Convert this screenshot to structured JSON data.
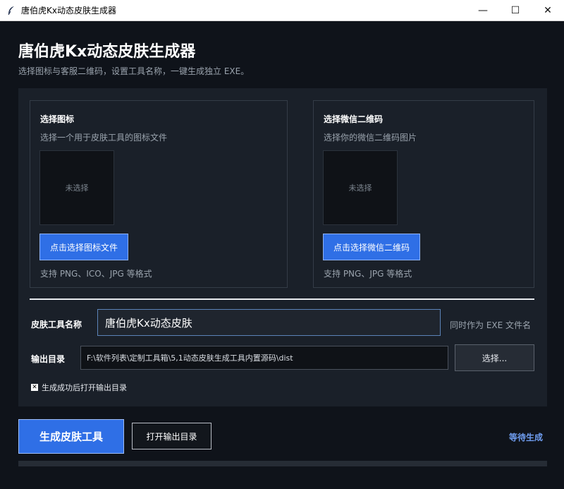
{
  "window": {
    "title": "唐伯虎Kx动态皮肤生成器",
    "controls": {
      "minimize": "—",
      "maximize": "☐",
      "close": "✕"
    }
  },
  "header": {
    "title": "唐伯虎Kx动态皮肤生成器",
    "subtitle": "选择图标与客服二维码，设置工具名称，一键生成独立 EXE。"
  },
  "icon_card": {
    "title": "选择图标",
    "description": "选择一个用于皮肤工具的图标文件",
    "preview_placeholder": "未选择",
    "button_label": "点击选择图标文件",
    "hint": "支持 PNG、ICO、JPG 等格式"
  },
  "qr_card": {
    "title": "选择微信二维码",
    "description": "选择你的微信二维码图片",
    "preview_placeholder": "未选择",
    "button_label": "点击选择微信二维码",
    "hint": "支持 PNG、JPG 等格式"
  },
  "form": {
    "name_label": "皮肤工具名称",
    "name_value": "唐伯虎Kx动态皮肤",
    "name_hint": "同时作为 EXE 文件名",
    "dir_label": "输出目录",
    "dir_value": "F:\\软件列表\\定制工具箱\\5,1动态皮肤生成工具内置源码\\dist",
    "browse_label": "选择...",
    "open_after_label": "生成成功后打开输出目录",
    "open_after_checked": true
  },
  "actions": {
    "generate_label": "生成皮肤工具",
    "open_dir_label": "打开输出目录",
    "status": "等待生成",
    "progress": 0
  },
  "colors": {
    "accent": "#2f6fe6",
    "status": "#6f9df0",
    "background": "#0f131a",
    "panel": "#1a2029"
  }
}
